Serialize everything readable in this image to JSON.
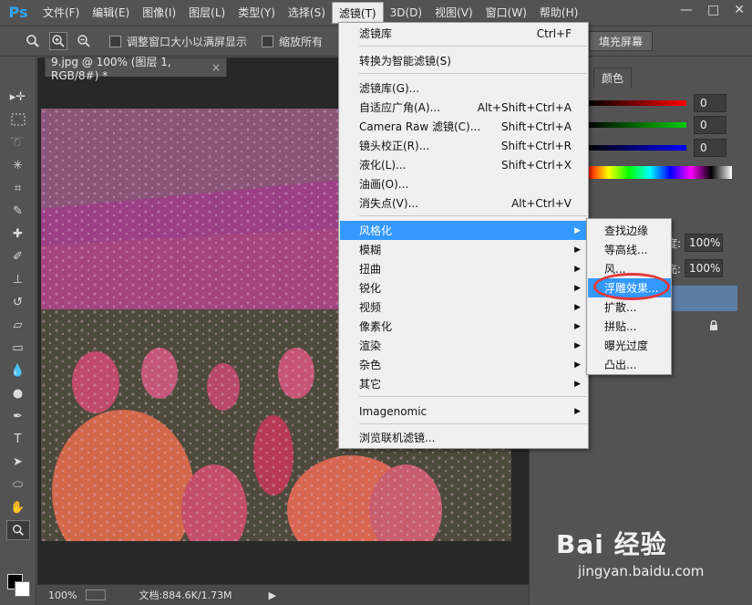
{
  "app": {
    "logo": "Ps"
  },
  "menubar": {
    "items": [
      {
        "label": "文件(F)"
      },
      {
        "label": "编辑(E)"
      },
      {
        "label": "图像(I)"
      },
      {
        "label": "图层(L)"
      },
      {
        "label": "类型(Y)"
      },
      {
        "label": "选择(S)"
      },
      {
        "label": "滤镜(T)",
        "active": true
      },
      {
        "label": "3D(D)"
      },
      {
        "label": "视图(V)"
      },
      {
        "label": "窗口(W)"
      },
      {
        "label": "帮助(H)"
      }
    ],
    "window_controls": [
      "—",
      "□",
      "✕"
    ]
  },
  "options": {
    "resize_label": "调整窗口大小以满屏显示",
    "zoom_all_label": "缩放所有",
    "fill_screen_label": "填充屏幕"
  },
  "document": {
    "tab_title": "9.jpg @ 100% (图层 1, RGB/8#) *",
    "tab_close": "×"
  },
  "status": {
    "zoom": "100%",
    "doc_info": "文档:884.6K/1.73M",
    "arrow": "▶"
  },
  "right_panel": {
    "tab_label": "颜色",
    "r_value": "0",
    "g_value": "0",
    "b_value": "0",
    "opacity_suffix": "度:",
    "opacity_value": "100%",
    "fill_suffix": "充:",
    "fill_value": "100%"
  },
  "filter_menu": {
    "items": [
      {
        "label": "滤镜库",
        "shortcut": "Ctrl+F"
      },
      {
        "label": "转换为智能滤镜(S)",
        "shortcut": ""
      },
      {
        "label": "滤镜库(G)...",
        "shortcut": ""
      },
      {
        "label": "自适应广角(A)...",
        "shortcut": "Alt+Shift+Ctrl+A"
      },
      {
        "label": "Camera Raw 滤镜(C)...",
        "shortcut": "Shift+Ctrl+A"
      },
      {
        "label": "镜头校正(R)...",
        "shortcut": "Shift+Ctrl+R"
      },
      {
        "label": "液化(L)...",
        "shortcut": "Shift+Ctrl+X"
      },
      {
        "label": "油画(O)...",
        "shortcut": ""
      },
      {
        "label": "消失点(V)...",
        "shortcut": "Alt+Ctrl+V"
      },
      {
        "label": "风格化",
        "submenu": true,
        "highlighted": true
      },
      {
        "label": "模糊",
        "submenu": true
      },
      {
        "label": "扭曲",
        "submenu": true
      },
      {
        "label": "锐化",
        "submenu": true
      },
      {
        "label": "视频",
        "submenu": true
      },
      {
        "label": "像素化",
        "submenu": true
      },
      {
        "label": "渲染",
        "submenu": true
      },
      {
        "label": "杂色",
        "submenu": true
      },
      {
        "label": "其它",
        "submenu": true
      },
      {
        "label": "Imagenomic",
        "submenu": true
      },
      {
        "label": "浏览联机滤镜...",
        "shortcut": ""
      }
    ]
  },
  "stylize_submenu": {
    "items": [
      {
        "label": "查找边缘"
      },
      {
        "label": "等高线..."
      },
      {
        "label": "风..."
      },
      {
        "label": "浮雕效果...",
        "highlighted": true
      },
      {
        "label": "扩散..."
      },
      {
        "label": "拼贴..."
      },
      {
        "label": "曝光过度"
      },
      {
        "label": "凸出..."
      }
    ]
  },
  "watermark": {
    "main": "Bai 经验",
    "sub": "jingyan.baidu.com"
  },
  "icons": {
    "zoom": "magnifier-icon",
    "submenu_arrow": "▶",
    "lock": "lock-icon"
  }
}
